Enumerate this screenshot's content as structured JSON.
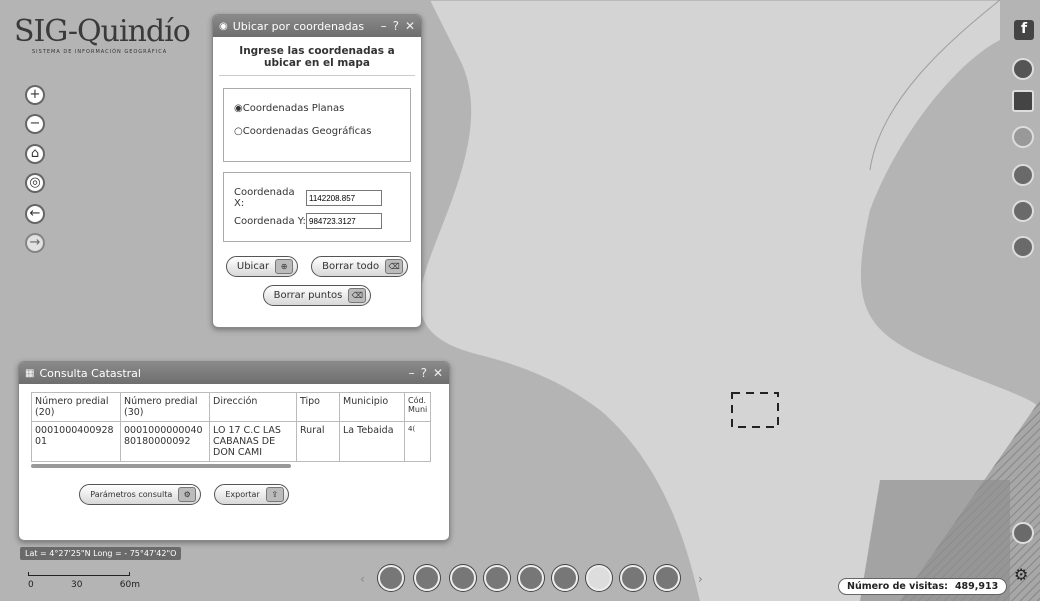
{
  "logo": {
    "title": "SIG-Quindío",
    "subtitle": "SISTEMA DE INFORMACIÓN GEOGRÁFICA"
  },
  "zoom_controls": [
    {
      "name": "zoom-in-button",
      "glyph": "+"
    },
    {
      "name": "zoom-out-button",
      "glyph": "−"
    },
    {
      "name": "home-button",
      "glyph": "⌂"
    },
    {
      "name": "locate-button",
      "glyph": "◎"
    },
    {
      "name": "back-button",
      "glyph": "←"
    },
    {
      "name": "forward-button",
      "glyph": "→"
    }
  ],
  "coord_panel": {
    "title": "Ubicar por coordenadas",
    "min": "–",
    "help": "?",
    "close": "✕",
    "heading": "Ingrese las coordenadas a ubicar en el mapa",
    "radio_planas": "Coordenadas Planas",
    "radio_geograficas": "Coordenadas Geográficas",
    "x_label": "Coordenada X:",
    "y_label": "Coordenada Y:",
    "x_value": "1142208.857",
    "y_value": "984723.3127",
    "ubicar": "Ubicar",
    "borrar_todo": "Borrar todo",
    "borrar_puntos": "Borrar puntos"
  },
  "catastro_panel": {
    "title": "Consulta Catastral",
    "min": "–",
    "help": "?",
    "close": "✕",
    "columns": [
      "Número predial (20)",
      "Número predial (30)",
      "Dirección",
      "Tipo",
      "Municipio",
      "Cód. Muni"
    ],
    "rows": [
      [
        "000100040092801",
        "000100000004080180000092",
        "LO 17 C.C LAS CABANAS DE DON CAMI",
        "Rural",
        "La Tebaida",
        "4("
      ]
    ],
    "btn_params": "Parámetros consulta",
    "btn_export": "Exportar"
  },
  "coords_readout": "Lat = 4°27'25\"N Long = - 75°47'42\"O",
  "scale": {
    "labels": [
      "0",
      "30",
      "60m"
    ]
  },
  "visits": {
    "label": "Número de visitas:",
    "value": "489,913"
  },
  "social_icons": [
    "facebook-icon",
    "twitter-icon",
    "youtube-icon",
    "layers-icon",
    "info-icon",
    "search-icon",
    "list-icon"
  ],
  "toolbar_icons": [
    "print-icon",
    "measure-icon",
    "globe-icon",
    "circle-icon",
    "swap-icon",
    "grid-icon",
    "globe-outline-icon",
    "pin-icon",
    "table-icon"
  ],
  "colors": {
    "titlebar": "#7a7a7a",
    "map_light": "#d8d8d8",
    "map_dark": "#9a9a9a"
  }
}
